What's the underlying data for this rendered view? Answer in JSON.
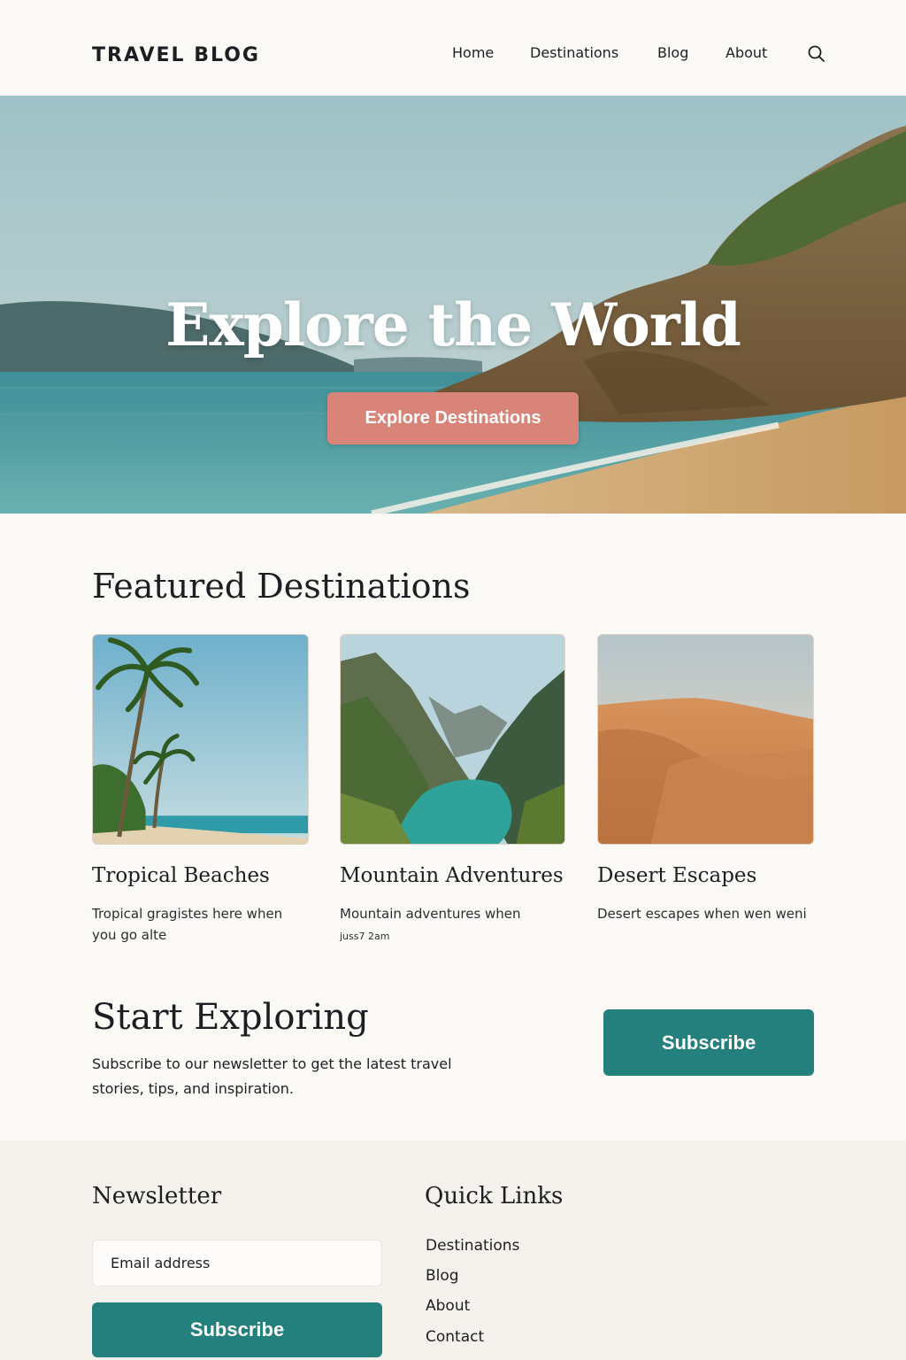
{
  "header": {
    "logo": "TRAVEL BLOG",
    "nav": [
      "Home",
      "Destinations",
      "Blog",
      "About"
    ],
    "search_icon": "search-icon"
  },
  "hero": {
    "title": "Explore the World",
    "button_label": "Explore Destinations",
    "button_color": "#d88478"
  },
  "featured": {
    "title": "Featured Destinations",
    "cards": [
      {
        "title": "Tropical Beaches",
        "desc": "Tropical gragistes here when you go alte",
        "image": "palm-beach-image"
      },
      {
        "title": "Mountain Adventures",
        "desc": "Mountain adventures when",
        "desc2": "juss7 2am",
        "image": "mountain-lake-image"
      },
      {
        "title": "Desert Escapes",
        "desc": "Desert escapes when wen weni",
        "image": "desert-dunes-image"
      }
    ]
  },
  "explore": {
    "title": "Start Exploring",
    "text": "Subscribe to our newsletter to get the latest travel stories, tips, and inspiration.",
    "button_label": "Subscribe"
  },
  "footer": {
    "newsletter_title": "Newsletter",
    "email_placeholder": "Email address",
    "subscribe_label": "Subscribe",
    "quick_links_title": "Quick Links",
    "quick_links": [
      "Destinations",
      "Blog",
      "About",
      "Contact"
    ]
  },
  "colors": {
    "accent": "#23807c",
    "coral": "#d88478",
    "background": "#fbf9f6"
  }
}
